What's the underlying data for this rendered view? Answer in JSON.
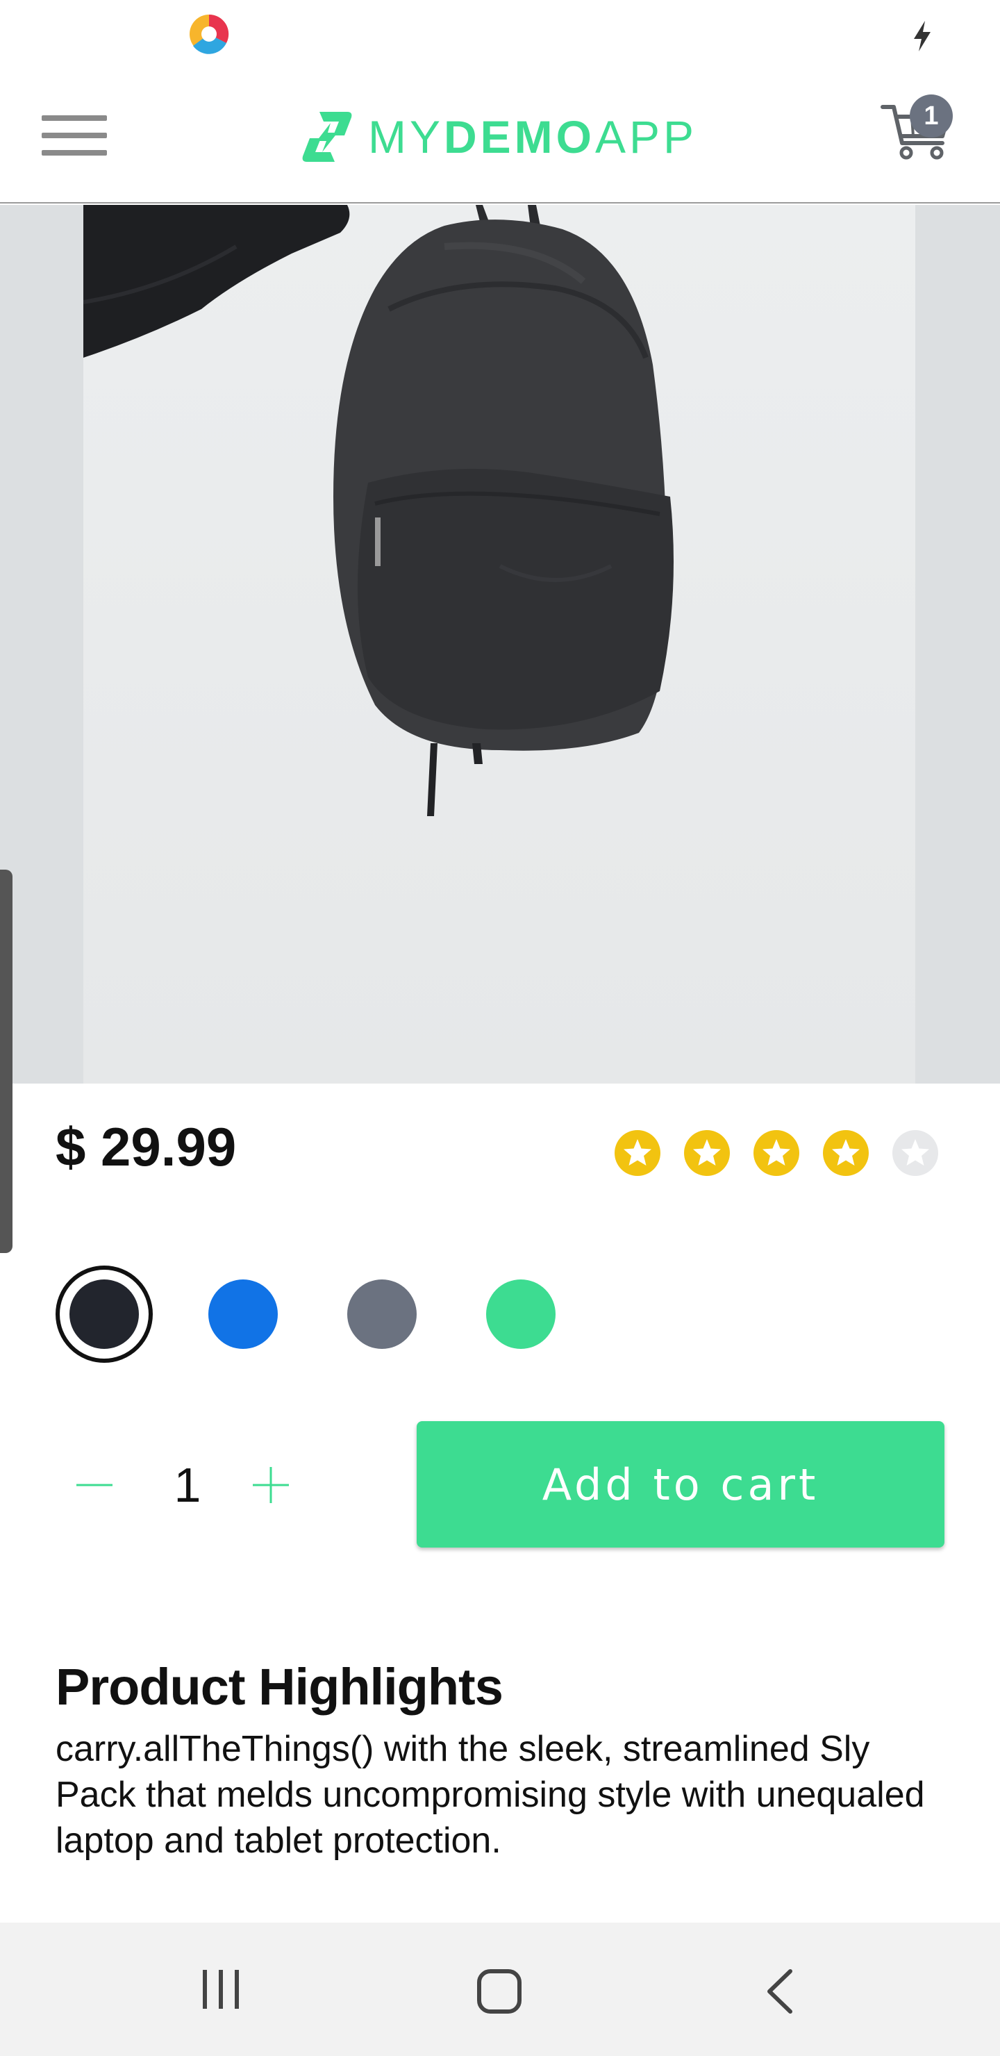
{
  "header": {
    "brand_light_prefix": "MY",
    "brand_bold": "DEMO",
    "brand_light_suffix": "APP",
    "cart_count": "1"
  },
  "product": {
    "image_alt": "Black backpack held up against a light gray wall",
    "price": "$ 29.99",
    "rating": 4,
    "rating_max": 5,
    "colors": [
      {
        "name": "black",
        "hex": "#22252d",
        "selected": true
      },
      {
        "name": "blue",
        "hex": "#1173e6",
        "selected": false
      },
      {
        "name": "gray",
        "hex": "#6b7280",
        "selected": false
      },
      {
        "name": "green",
        "hex": "#3ddc91",
        "selected": false
      }
    ],
    "quantity": "1",
    "add_to_cart_label": "Add to cart"
  },
  "highlights": {
    "title": "Product Highlights",
    "text": "carry.allTheThings() with the sleek, streamlined Sly Pack that melds uncompromising style with unequaled laptop and tablet protection."
  },
  "theme": {
    "accent": "#3ddc91",
    "star_filled": "#f2c310",
    "star_empty": "#e7e8ea"
  }
}
